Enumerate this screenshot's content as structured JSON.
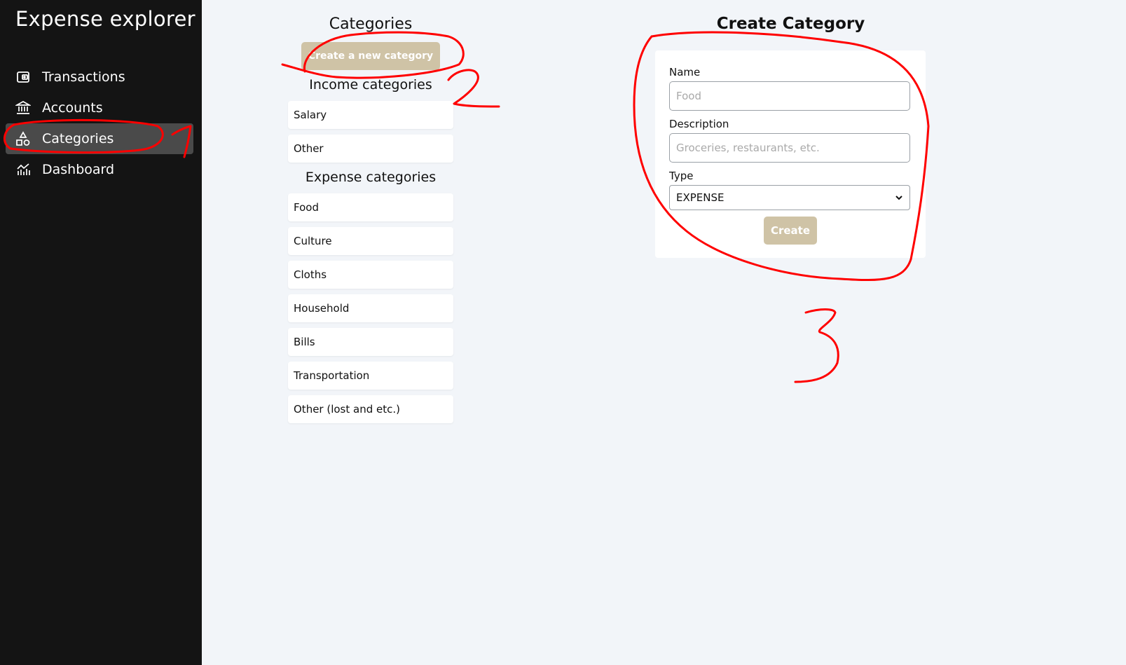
{
  "sidebar": {
    "brand": "Expense explorer",
    "items": [
      {
        "label": "Transactions",
        "icon": "wallet-icon",
        "active": false
      },
      {
        "label": "Accounts",
        "icon": "bank-icon",
        "active": false
      },
      {
        "label": "Categories",
        "icon": "shapes-icon",
        "active": true
      },
      {
        "label": "Dashboard",
        "icon": "chart-icon",
        "active": false
      }
    ]
  },
  "categories": {
    "title": "Categories",
    "new_button": "Create a new category",
    "income_heading": "Income categories",
    "income": [
      "Salary",
      "Other"
    ],
    "expense_heading": "Expense categories",
    "expense": [
      "Food",
      "Culture",
      "Cloths",
      "Household",
      "Bills",
      "Transportation",
      "Other (lost and etc.)"
    ]
  },
  "create_form": {
    "title": "Create Category",
    "name_label": "Name",
    "name_placeholder": "Food",
    "description_label": "Description",
    "description_placeholder": "Groceries, restaurants, etc.",
    "type_label": "Type",
    "type_value": "EXPENSE",
    "submit_label": "Create"
  },
  "annotations": {
    "color": "#ff0000",
    "marks": [
      "1",
      "2",
      "3"
    ]
  },
  "colors": {
    "sidebar_bg": "#141414",
    "active_nav_bg": "#4a4a4a",
    "accent_button": "#cfc3a6",
    "page_bg": "#f2f5f9"
  }
}
